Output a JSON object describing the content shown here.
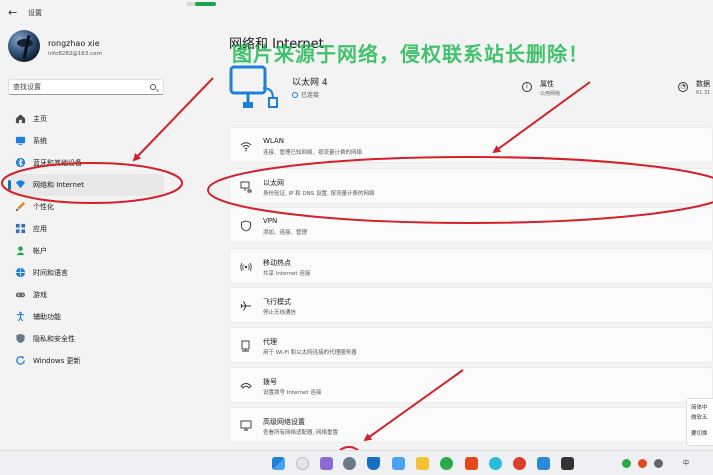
{
  "window": {
    "app_title": "设置"
  },
  "account": {
    "name": "rongzhao xie",
    "email": "info8282@163.com"
  },
  "search": {
    "placeholder": "查找设置"
  },
  "nav": {
    "items": [
      {
        "label": "主页",
        "icon": "home-icon"
      },
      {
        "label": "系统",
        "icon": "system-icon"
      },
      {
        "label": "蓝牙和其他设备",
        "icon": "bluetooth-icon"
      },
      {
        "label": "网络和 Internet",
        "icon": "network-icon",
        "selected": true
      },
      {
        "label": "个性化",
        "icon": "brush-icon"
      },
      {
        "label": "应用",
        "icon": "apps-icon"
      },
      {
        "label": "帐户",
        "icon": "account-icon"
      },
      {
        "label": "时间和语言",
        "icon": "time-language-icon"
      },
      {
        "label": "游戏",
        "icon": "gaming-icon"
      },
      {
        "label": "辅助功能",
        "icon": "accessibility-icon"
      },
      {
        "label": "隐私和安全性",
        "icon": "privacy-shield-icon"
      },
      {
        "label": "Windows 更新",
        "icon": "windows-update-icon"
      }
    ]
  },
  "main": {
    "title": "网络和 Internet",
    "hero": {
      "name": "以太网 4",
      "status": "已连接",
      "properties": {
        "title": "属性",
        "sub": "公用网络"
      },
      "data_usage": {
        "title": "数据",
        "sub": "61.31"
      }
    },
    "cards": [
      {
        "title": "WLAN",
        "sub": "连接、管理已知网络、按流量计费的网络",
        "icon": "wifi-icon"
      },
      {
        "title": "以太网",
        "sub": "身份验证, IP 和 DNS 设置, 按流量计费的网络",
        "icon": "ethernet-icon"
      },
      {
        "title": "VPN",
        "sub": "添加、连接、管理",
        "icon": "vpn-shield-icon"
      },
      {
        "title": "移动热点",
        "sub": "共享 Internet 连接",
        "icon": "hotspot-icon"
      },
      {
        "title": "飞行模式",
        "sub": "停止无线通信",
        "icon": "airplane-icon"
      },
      {
        "title": "代理",
        "sub": "用于 Wi-Fi 和以太网连接的代理服务器",
        "icon": "proxy-icon"
      },
      {
        "title": "拨号",
        "sub": "设置拨号 Internet 连接",
        "icon": "dialup-icon"
      },
      {
        "title": "高级网络设置",
        "sub": "查看所有网络适配器, 网络重置",
        "icon": "advanced-network-icon"
      }
    ]
  },
  "watermark": "图片来源于网络，侵权联系站长删除！",
  "side_popup": {
    "line1": "简体中",
    "line2": "微软五",
    "line3": "要切换"
  },
  "taskbar": {
    "tray_label": "中"
  },
  "colors": {
    "accent": "#1470c4",
    "annotation_red": "#d4202a",
    "watermark_green": "#10b446"
  }
}
